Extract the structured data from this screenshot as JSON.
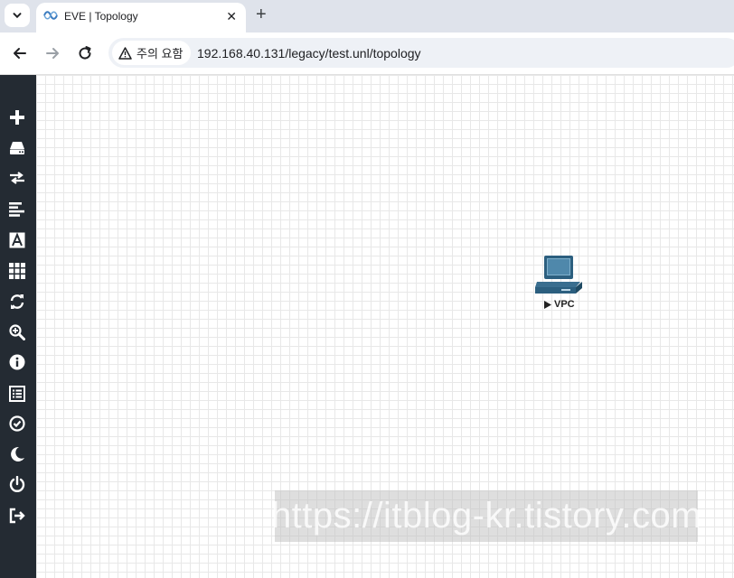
{
  "browser": {
    "tab": {
      "title": "EVE | Topology",
      "close_glyph": "✕"
    },
    "new_tab_glyph": "+",
    "security": {
      "label": "주의 요함",
      "icon": "warning-icon"
    },
    "url": "192.168.40.131/legacy/test.unl/topology"
  },
  "sidebar": {
    "items": [
      {
        "name": "add-object",
        "icon": "plus-icon"
      },
      {
        "name": "nodes",
        "icon": "hdd-icon"
      },
      {
        "name": "networks",
        "icon": "exchange-icon"
      },
      {
        "name": "startup-configs",
        "icon": "align-left-icon"
      },
      {
        "name": "text-objects",
        "icon": "font-icon"
      },
      {
        "name": "layout",
        "icon": "grid-icon"
      },
      {
        "name": "refresh",
        "icon": "refresh-icon"
      },
      {
        "name": "zoom",
        "icon": "zoom-in-icon"
      },
      {
        "name": "status",
        "icon": "info-icon"
      },
      {
        "name": "lab-details",
        "icon": "list-icon"
      },
      {
        "name": "lock-lab",
        "icon": "check-circle-icon"
      },
      {
        "name": "dark-mode",
        "icon": "moon-icon"
      },
      {
        "name": "close-lab",
        "icon": "power-icon"
      },
      {
        "name": "logout",
        "icon": "sign-out-icon"
      }
    ]
  },
  "topology": {
    "nodes": [
      {
        "label": "VPC",
        "type": "vpc",
        "icon": "computer-icon",
        "status_icon": "play-icon"
      }
    ]
  },
  "watermark": "https://itblog-kr.tistory.com",
  "colors": {
    "sidebar_bg": "#242b33",
    "tabstrip_bg": "#dfe3eb",
    "omnibox_bg": "#eef1f6",
    "node_blue": "#3a6e8f"
  }
}
